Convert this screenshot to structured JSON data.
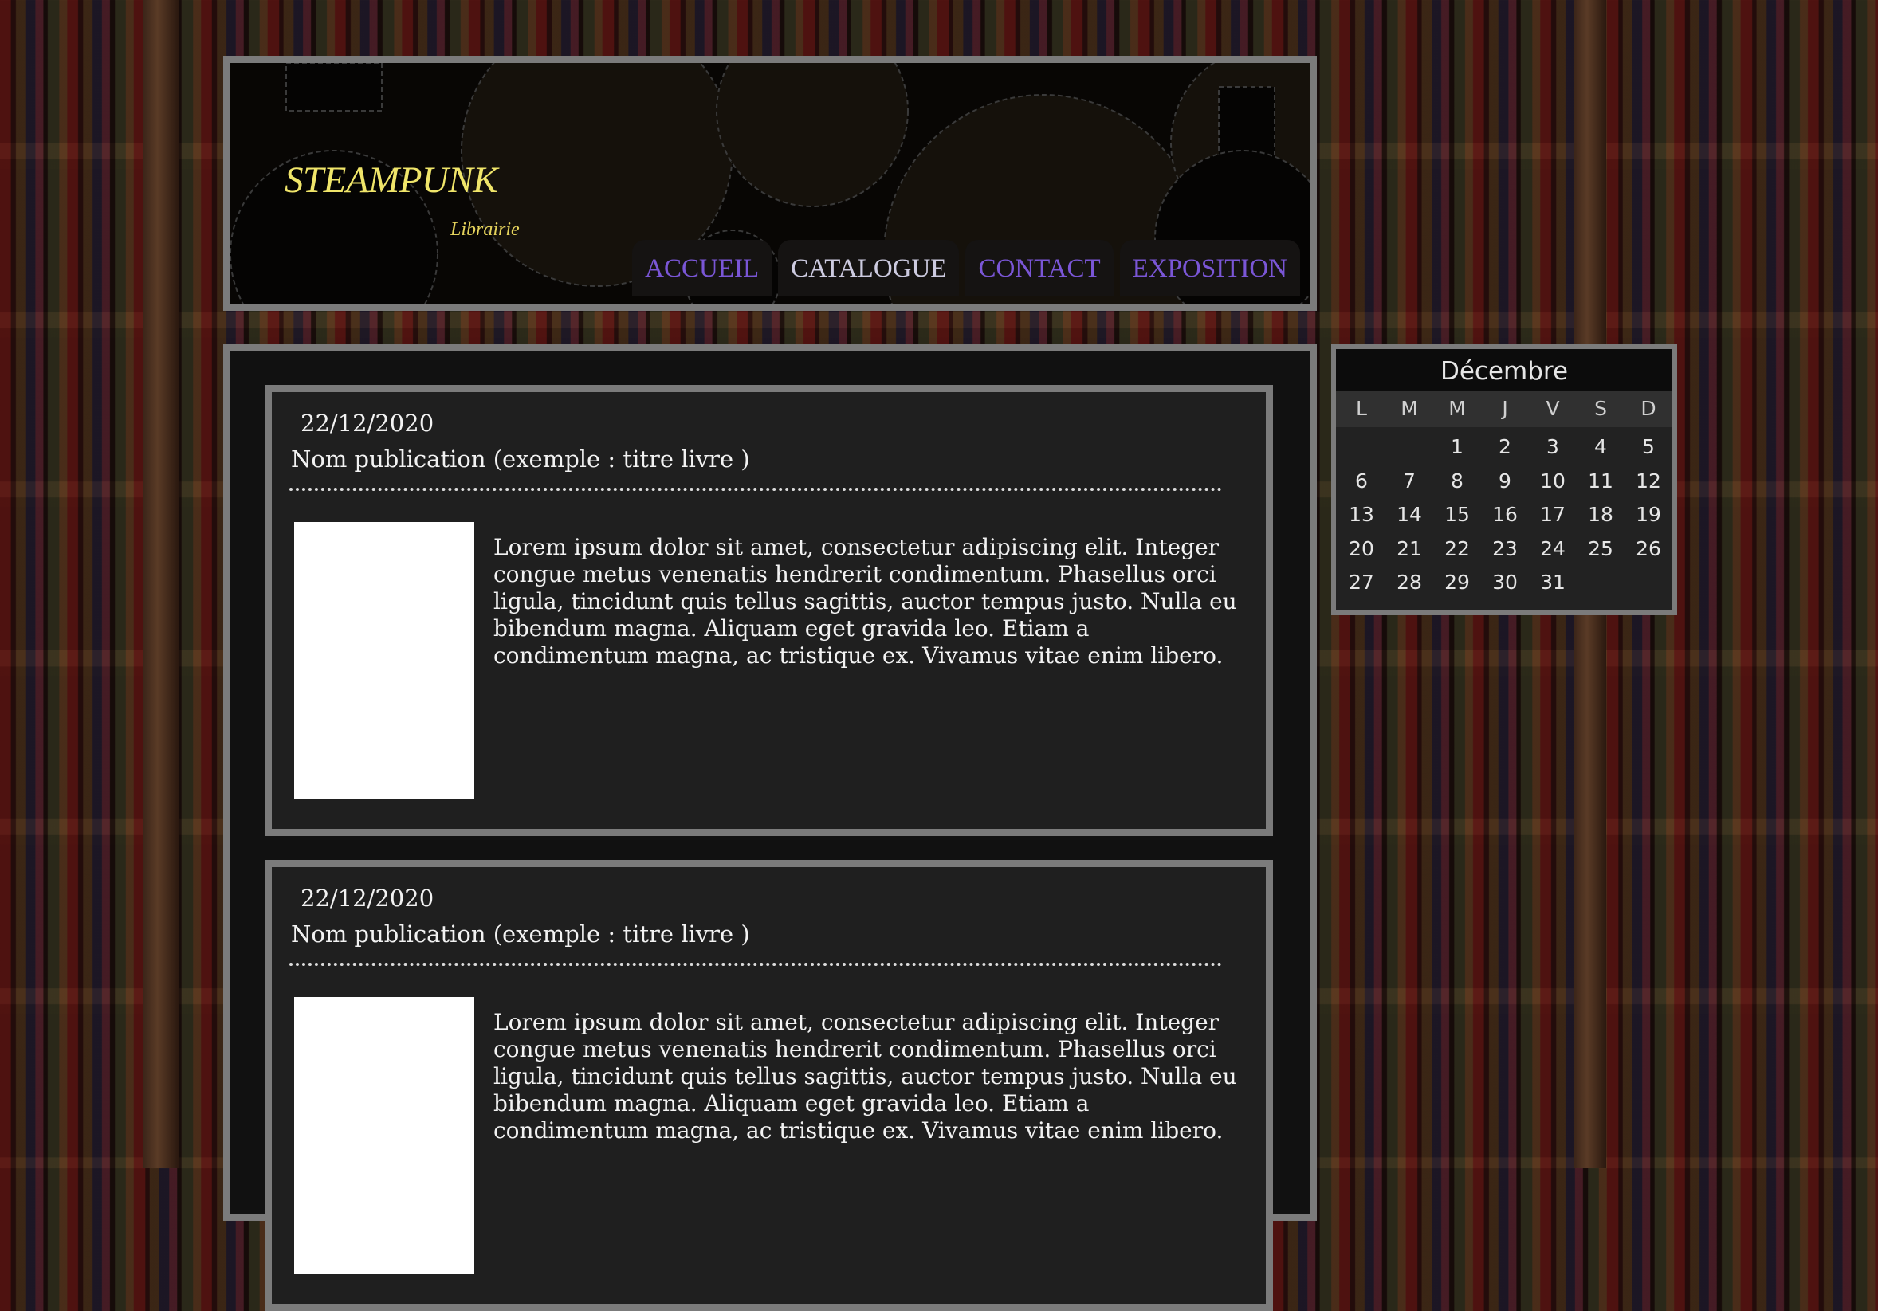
{
  "header": {
    "brand_title": "STEAMPUNK",
    "brand_subtitle": "Librairie",
    "nav": [
      {
        "label": "ACCUEIL",
        "active": false
      },
      {
        "label": "CATALOGUE",
        "active": true
      },
      {
        "label": "CONTACT",
        "active": false
      },
      {
        "label": "EXPOSITION",
        "active": false
      }
    ]
  },
  "posts": [
    {
      "date": "22/12/2020",
      "title": "Nom publication (exemple : titre livre )",
      "text": "Lorem ipsum dolor sit amet, consectetur adipiscing elit. Integer congue metus venenatis hendrerit condimentum. Phasellus orci ligula, tincidunt quis tellus sagittis, auctor tempus justo. Nulla eu bibendum magna. Aliquam eget gravida leo. Etiam a condimentum magna, ac tristique ex. Vivamus vitae enim libero."
    },
    {
      "date": "22/12/2020",
      "title": "Nom publication (exemple : titre livre )",
      "text": "Lorem ipsum dolor sit amet, consectetur adipiscing elit. Integer congue metus venenatis hendrerit condimentum. Phasellus orci ligula, tincidunt quis tellus sagittis, auctor tempus justo. Nulla eu bibendum magna. Aliquam eget gravida leo. Etiam a condimentum magna, ac tristique ex. Vivamus vitae enim libero."
    }
  ],
  "calendar": {
    "month": "Décembre",
    "weekdays": [
      "L",
      "M",
      "M",
      "J",
      "V",
      "S",
      "D"
    ],
    "leading_blanks": 2,
    "days": [
      "1",
      "2",
      "3",
      "4",
      "5",
      "6",
      "7",
      "8",
      "9",
      "10",
      "11",
      "12",
      "13",
      "14",
      "15",
      "16",
      "17",
      "18",
      "19",
      "20",
      "21",
      "22",
      "23",
      "24",
      "25",
      "26",
      "27",
      "28",
      "29",
      "30",
      "31"
    ]
  },
  "colors": {
    "brand": "#f0e56a",
    "nav_link": "#7a56d6",
    "nav_active": "#cdcbe0",
    "frame": "#7b7b7b",
    "panel": "#1f1f1f"
  }
}
